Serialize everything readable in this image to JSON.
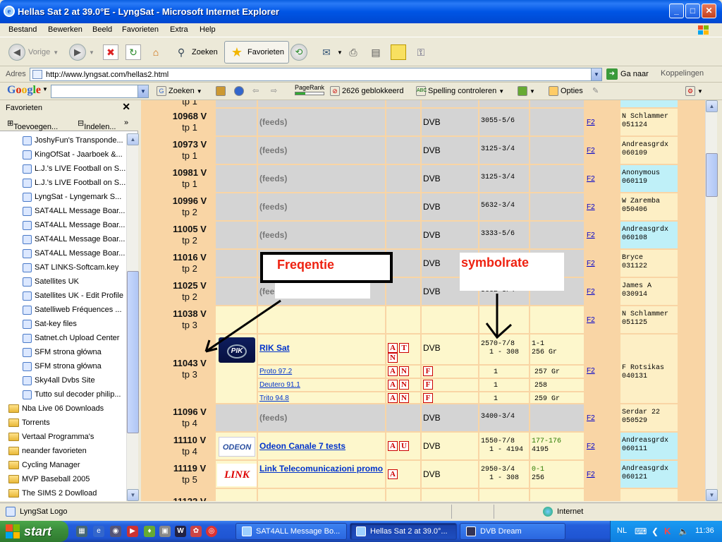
{
  "window": {
    "title": "Hellas Sat 2 at 39.0°E - LyngSat - Microsoft Internet Explorer"
  },
  "menu": [
    "Bestand",
    "Bewerken",
    "Beeld",
    "Favorieten",
    "Extra",
    "Help"
  ],
  "toolbar": {
    "back": "Vorige",
    "search": "Zoeken",
    "favorites": "Favorieten"
  },
  "address": {
    "label": "Adres",
    "url": "http://www.lyngsat.com/hellas2.html",
    "go": "Ga naar",
    "links": "Koppelingen"
  },
  "google": {
    "logo": "Google",
    "search": "Zoeken",
    "pagerank": "PageRank",
    "blocked": "2626 geblokkeerd",
    "spell": "Spelling controleren",
    "options": "Opties"
  },
  "favpane": {
    "title": "Favorieten",
    "add": "Toevoegen...",
    "organize": "Indelen...",
    "items": [
      {
        "label": "JoshyFun's Transponde...",
        "type": "link"
      },
      {
        "label": "KingOfSat - Jaarboek &...",
        "type": "link"
      },
      {
        "label": "L.J.'s LIVE Football on S...",
        "type": "link"
      },
      {
        "label": "L.J.'s LIVE Football on S...",
        "type": "link"
      },
      {
        "label": "LyngSat - Lyngemark S...",
        "type": "link"
      },
      {
        "label": "SAT4ALL Message Boar...",
        "type": "link"
      },
      {
        "label": "SAT4ALL Message Boar...",
        "type": "link"
      },
      {
        "label": "SAT4ALL Message Boar...",
        "type": "link"
      },
      {
        "label": "SAT4ALL Message Boar...",
        "type": "link"
      },
      {
        "label": "SAT LINKS-Softcam.key",
        "type": "link"
      },
      {
        "label": "Satellites UK",
        "type": "link"
      },
      {
        "label": "Satellites UK - Edit Profile",
        "type": "link"
      },
      {
        "label": "Satelliweb Fréquences ...",
        "type": "link"
      },
      {
        "label": "Sat-key files",
        "type": "link"
      },
      {
        "label": "Satnet.ch Upload Center",
        "type": "link"
      },
      {
        "label": "SFM  strona główna",
        "type": "link"
      },
      {
        "label": "SFM  strona główna",
        "type": "link"
      },
      {
        "label": "Sky4all Dvbs Site",
        "type": "link"
      },
      {
        "label": "Tutto sul decoder philip...",
        "type": "link"
      },
      {
        "label": "Nba Live 06 Downloads",
        "type": "folder"
      },
      {
        "label": "Torrents",
        "type": "folder"
      },
      {
        "label": "Vertaal Programma's",
        "type": "folder"
      },
      {
        "label": "neander favorieten",
        "type": "folder"
      },
      {
        "label": "Cycling Manager",
        "type": "folder"
      },
      {
        "label": "MVP Baseball 2005",
        "type": "folder"
      },
      {
        "label": "The SIMS 2 Dowlload",
        "type": "folder"
      }
    ]
  },
  "table": {
    "top_tp": "tp 1",
    "rows": [
      {
        "freq": "10968 V",
        "tp": "tp 1",
        "feeds": "(feeds)",
        "system": "DVB",
        "sr": "3055-5/6",
        "src": "F2",
        "upd": [
          "N Schlammer",
          "051124"
        ],
        "upd_cyan": false
      },
      {
        "freq": "10973 V",
        "tp": "tp 1",
        "feeds": "(feeds)",
        "system": "DVB",
        "sr": "3125-3/4",
        "src": "F2",
        "upd": [
          "Andreasgrdx",
          "060109"
        ],
        "upd_cyan": false
      },
      {
        "freq": "10981 V",
        "tp": "tp 1",
        "feeds": "(feeds)",
        "system": "DVB",
        "sr": "3125-3/4",
        "src": "F2",
        "upd": [
          "Anonymous",
          "060119"
        ],
        "upd_cyan": true
      },
      {
        "freq": "10996 V",
        "tp": "tp 2",
        "feeds": "(feeds)",
        "system": "DVB",
        "sr": "5632-3/4",
        "src": "F2",
        "upd": [
          "W Zaremba",
          "050406"
        ],
        "upd_cyan": false
      },
      {
        "freq": "11005 V",
        "tp": "tp 2",
        "feeds": "(feeds)",
        "system": "DVB",
        "sr": "3333-5/6",
        "src": "F2",
        "upd": [
          "Andreasgrdx",
          "060108"
        ],
        "upd_cyan": true
      },
      {
        "freq": "11016 V",
        "tp": "tp 2",
        "feeds": "",
        "system": "DVB",
        "sr": "",
        "src": "F2",
        "upd": [
          "Bryce",
          "031122"
        ],
        "upd_cyan": false
      },
      {
        "freq": "11025 V",
        "tp": "tp 2",
        "feeds": "(fee",
        "system": "DVB",
        "sr": "5632-3/4",
        "src": "F2",
        "upd": [
          "James A",
          "030914"
        ],
        "upd_cyan": false
      }
    ],
    "empty_row": {
      "freq": "11038 V",
      "tp": "tp 3",
      "src": "F2",
      "upd": [
        "N Schlammer",
        "051125"
      ]
    },
    "rik": {
      "freq": "11043 V",
      "tp": "tp 3",
      "logo": "PIK",
      "name": "RIK Sat",
      "icons": [
        "A",
        "T",
        "N"
      ],
      "system": "DVB",
      "sr": [
        "2570-7/8",
        "1 - 308"
      ],
      "vpid": [
        "1-1",
        "256 Gr"
      ],
      "src": "F2",
      "upd": [
        "F Rotsikas",
        "040131"
      ],
      "subs": [
        {
          "name": "Proto 97.2",
          "icons": [
            "A",
            "N"
          ],
          "f": "F",
          "sid": "1",
          "pid": "257 Gr"
        },
        {
          "name": "Deutero 91.1",
          "icons": [
            "A",
            "N"
          ],
          "f": "F",
          "sid": "1",
          "pid": "258"
        },
        {
          "name": "Trito 94.8",
          "icons": [
            "A",
            "N"
          ],
          "f": "F",
          "sid": "1",
          "pid": "259 Gr"
        }
      ]
    },
    "row_11096": {
      "freq": "11096 V",
      "tp": "tp 4",
      "feeds": "(feeds)",
      "system": "DVB",
      "sr": "3400-3/4",
      "src": "F2",
      "upd": [
        "Serdar 22",
        "050529"
      ]
    },
    "odeon": {
      "freq": "11110 V",
      "tp": "tp 4",
      "logo": "ODEON",
      "name": "Odeon Canale 7 tests",
      "icons": [
        "A",
        "U"
      ],
      "system": "DVB",
      "sr": [
        "1550-7/8",
        "1 - 4194"
      ],
      "vpid": [
        "177-176",
        "4195"
      ],
      "src": "F2",
      "upd": [
        "Andreasgrdx",
        "060111"
      ]
    },
    "link": {
      "freq": "11119 V",
      "tp": "tp 5",
      "logo": "LINK",
      "name": "Link Telecomunicazioni promo",
      "icons": [
        "A"
      ],
      "system": "DVB",
      "sr": [
        "2950-3/4",
        "1 - 308"
      ],
      "vpid": [
        "0-1",
        "256"
      ],
      "src": "F2",
      "upd": [
        "Andreasgrdx",
        "060121"
      ]
    },
    "last": {
      "freq": "11122 V"
    }
  },
  "annotations": {
    "freq": "Freqentie",
    "sr": "symbolrate"
  },
  "status": {
    "text": "LyngSat Logo",
    "zone": "Internet"
  },
  "taskbar": {
    "start": "start",
    "tasks": [
      "SAT4ALL Message Bo...",
      "Hellas Sat 2 at 39.0°...",
      "DVB Dream"
    ],
    "lang": "NL",
    "time": "11:36"
  }
}
